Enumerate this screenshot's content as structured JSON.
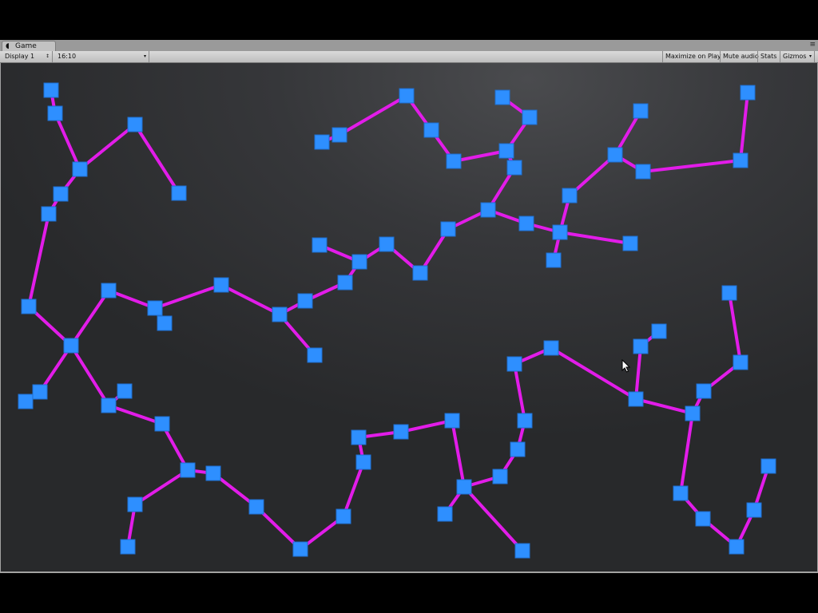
{
  "window": {
    "tab_label": "Game",
    "tab_icon": "unity-game-icon",
    "tab_menu_icon": "panel-menu-icon",
    "tab_menu_glyph": "≡"
  },
  "toolbar": {
    "display_label": "Display 1",
    "display_arrow": "↕",
    "aspect_label": "16:10",
    "aspect_arrow": "▾",
    "maximize_label": "Maximize on Play",
    "mute_label": "Mute audio",
    "stats_label": "Stats",
    "gizmos_label": "Gizmos",
    "gizmos_arrow": "▾"
  },
  "graph": {
    "node_color": "#2e8fff",
    "edge_color": "#e21ce9",
    "node_count": 76,
    "edge_count": 73
  },
  "cursor": {
    "icon": "mouse-pointer-icon"
  }
}
